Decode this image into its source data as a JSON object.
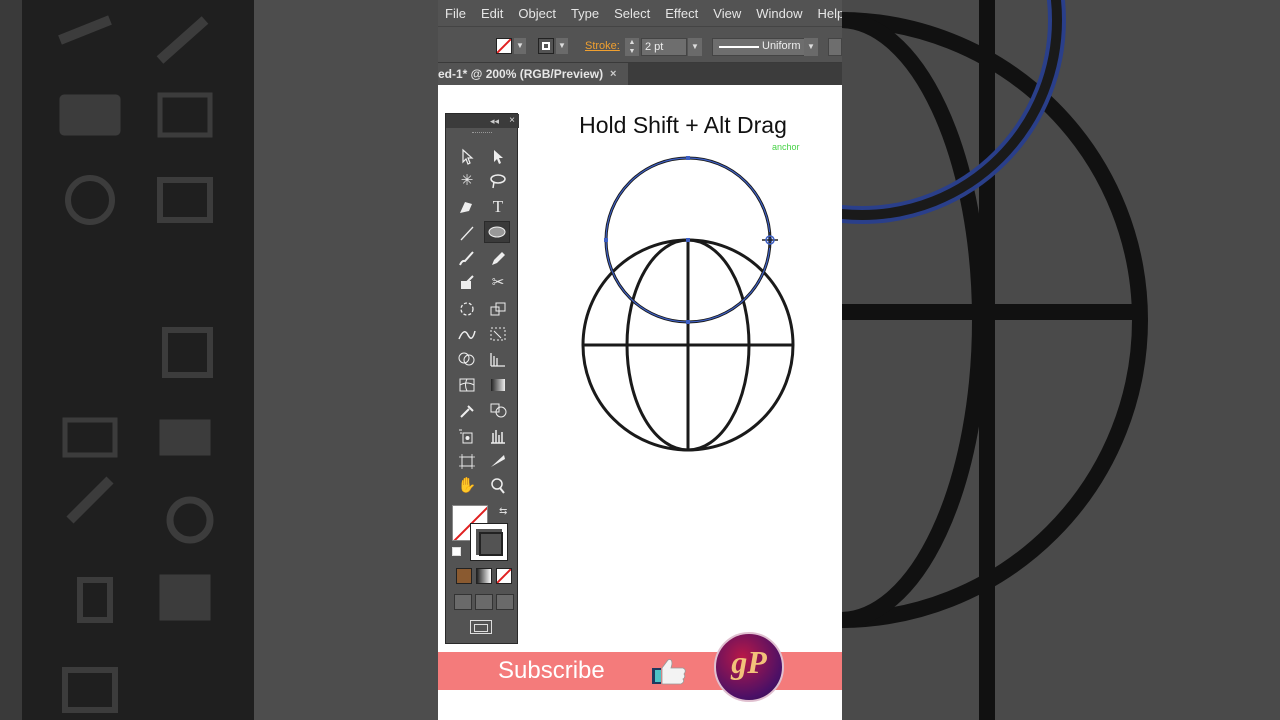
{
  "menu": [
    "File",
    "Edit",
    "Object",
    "Type",
    "Select",
    "Effect",
    "View",
    "Window",
    "Help"
  ],
  "control_bar": {
    "stroke_label": "Stroke:",
    "stroke_weight": "2 pt",
    "profile": "Uniform"
  },
  "document_tab": {
    "title": "ed-1* @ 200% (RGB/Preview)",
    "close": "×"
  },
  "canvas": {
    "headline": "Hold Shift + Alt Drag",
    "cursor_hint": "anchor"
  },
  "toolbox": {
    "collapse": "◂◂",
    "close": "×"
  },
  "banner": {
    "subscribe": "Subscribe",
    "logo_text": "gP"
  },
  "colors": {
    "ui_dark": "#535353",
    "accent_orange": "#f0a030",
    "selection_blue": "#3d5fc4",
    "banner_pink": "#f47b7b"
  }
}
